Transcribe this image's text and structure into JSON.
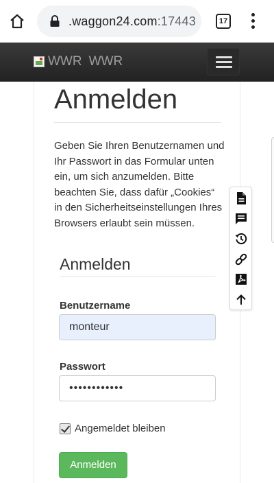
{
  "browser": {
    "url_host": ".waggon24.com",
    "url_port": ":17443",
    "tab_count": "17"
  },
  "navbar": {
    "brand_alt": "WWR",
    "brand_text": "WWR"
  },
  "page": {
    "title": "Anmelden",
    "intro": "Geben Sie Ihren Benutzernamen und Ihr Passwort in das Formular unten ein, um sich anzumelden. Bitte beachten Sie, dass dafür „Cookies“ in den Sicherheitseinstellungen Ihres Browsers erlaubt sein müssen."
  },
  "form": {
    "heading": "Anmelden",
    "username_label": "Benutzername",
    "username_value": "monteur",
    "password_label": "Passwort",
    "password_value": "••••••••••••",
    "remember_label": "Angemeldet bleiben",
    "remember_checked": true,
    "submit_label": "Anmelden",
    "submit_color": "#5cb85c"
  },
  "tools": [
    "document-icon",
    "comment-icon",
    "history-icon",
    "link-icon",
    "pdf-icon",
    "arrow-up-icon"
  ]
}
